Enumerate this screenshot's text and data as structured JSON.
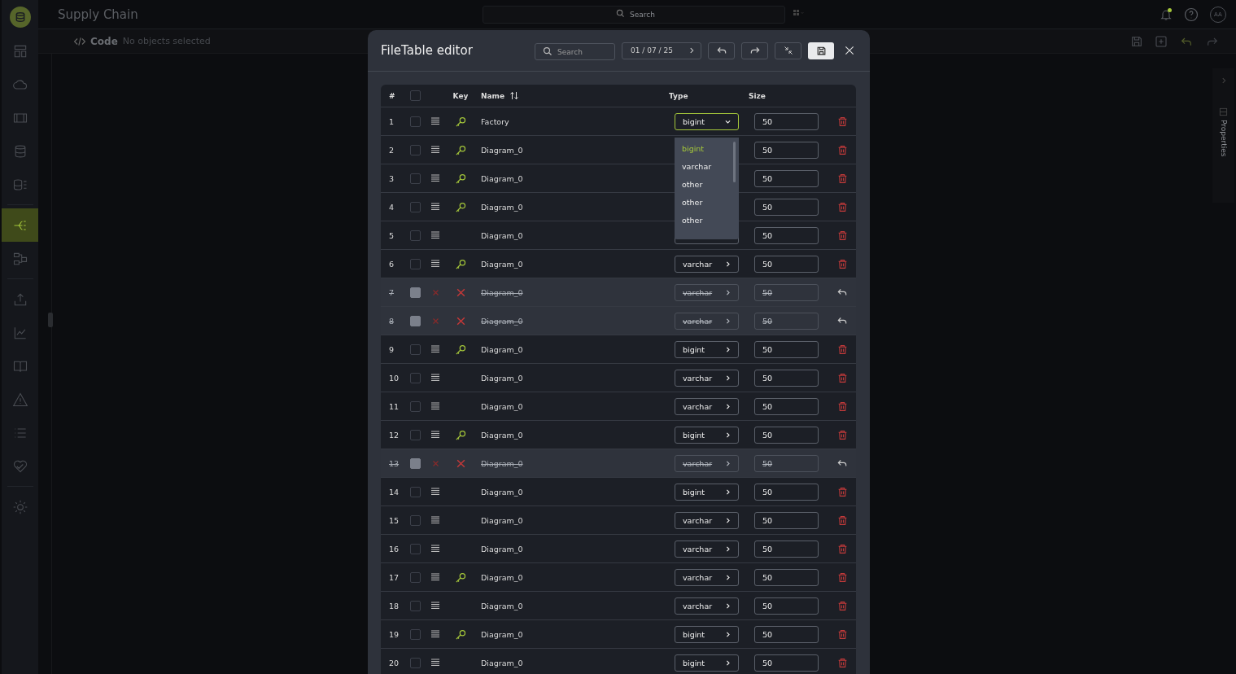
{
  "app": {
    "title": "Supply Chain",
    "search": {
      "placeholder": "Search"
    },
    "avatar": "AA",
    "notification": true
  },
  "toolbar": {
    "label": "Code",
    "status": "No objects selected"
  },
  "sidebar": {
    "items": [
      {
        "selected": false
      },
      {
        "selected": false
      },
      {
        "selected": false
      },
      {
        "selected": false
      },
      {
        "selected": false
      },
      {
        "selected": true
      },
      {
        "selected": false
      },
      {
        "selected": false
      },
      {
        "selected": false
      },
      {
        "selected": false
      },
      {
        "selected": false
      },
      {
        "selected": false
      },
      {
        "selected": false
      },
      {
        "selected": false
      }
    ]
  },
  "right_panel": {
    "label": "Properties"
  },
  "dialog": {
    "title": "FileTable editor",
    "search": {
      "placeholder": "Search"
    },
    "date": "01 / 07 / 25",
    "table": {
      "columns": {
        "number": "#",
        "key": "Key",
        "name": "Name",
        "type": "Type",
        "size": "Size"
      },
      "all_checked": false,
      "type_menu": {
        "options": [
          {
            "label": "bigint",
            "selected": true
          },
          {
            "label": "varchar",
            "selected": false
          },
          {
            "label": "other",
            "selected": false
          },
          {
            "label": "other",
            "selected": false
          },
          {
            "label": "other",
            "selected": false
          }
        ]
      },
      "rows": [
        {
          "number": "1",
          "checked": false,
          "key": true,
          "name": "Factory",
          "type": "bigint",
          "size": "50",
          "deleted": false,
          "menu_open": true
        },
        {
          "number": "2",
          "checked": false,
          "key": true,
          "name": "Diagram_0",
          "size": "50",
          "deleted": false,
          "menu_open": false
        },
        {
          "number": "3",
          "checked": false,
          "key": true,
          "name": "Diagram_0",
          "size": "50",
          "deleted": false,
          "menu_open": false
        },
        {
          "number": "4",
          "checked": false,
          "key": true,
          "name": "Diagram_0",
          "size": "50",
          "deleted": false,
          "menu_open": false
        },
        {
          "number": "5",
          "checked": false,
          "key": false,
          "name": "Diagram_0",
          "size": "50",
          "deleted": false,
          "menu_open": false
        },
        {
          "number": "6",
          "checked": false,
          "key": true,
          "name": "Diagram_0",
          "type": "varchar",
          "size": "50",
          "deleted": false,
          "menu_open": false
        },
        {
          "number": "7",
          "checked": true,
          "name": "Diagram_0",
          "type": "varchar",
          "size": "50",
          "deleted": true,
          "menu_open": false
        },
        {
          "number": "8",
          "checked": true,
          "name": "Diagram_0",
          "type": "varchar",
          "size": "50",
          "deleted": true,
          "menu_open": false
        },
        {
          "number": "9",
          "checked": false,
          "key": true,
          "name": "Diagram_0",
          "type": "bigint",
          "size": "50",
          "deleted": false,
          "menu_open": false
        },
        {
          "number": "10",
          "checked": false,
          "key": false,
          "name": "Diagram_0",
          "type": "varchar",
          "size": "50",
          "deleted": false,
          "menu_open": false
        },
        {
          "number": "11",
          "checked": false,
          "key": false,
          "name": "Diagram_0",
          "type": "varchar",
          "size": "50",
          "deleted": false,
          "menu_open": false
        },
        {
          "number": "12",
          "checked": false,
          "key": true,
          "name": "Diagram_0",
          "type": "bigint",
          "size": "50",
          "deleted": false,
          "menu_open": false
        },
        {
          "number": "13",
          "checked": true,
          "name": "Diagram_0",
          "type": "varchar",
          "size": "50",
          "deleted": true,
          "menu_open": false
        },
        {
          "number": "14",
          "checked": false,
          "key": false,
          "name": "Diagram_0",
          "type": "bigint",
          "size": "50",
          "deleted": false,
          "menu_open": false
        },
        {
          "number": "15",
          "checked": false,
          "key": false,
          "name": "Diagram_0",
          "type": "varchar",
          "size": "50",
          "deleted": false,
          "menu_open": false
        },
        {
          "number": "16",
          "checked": false,
          "key": false,
          "name": "Diagram_0",
          "type": "varchar",
          "size": "50",
          "deleted": false,
          "menu_open": false
        },
        {
          "number": "17",
          "checked": false,
          "key": true,
          "name": "Diagram_0",
          "type": "varchar",
          "size": "50",
          "deleted": false,
          "menu_open": false
        },
        {
          "number": "18",
          "checked": false,
          "key": false,
          "name": "Diagram_0",
          "type": "varchar",
          "size": "50",
          "deleted": false,
          "menu_open": false
        },
        {
          "number": "19",
          "checked": false,
          "key": true,
          "name": "Diagram_0",
          "type": "bigint",
          "size": "50",
          "deleted": false,
          "menu_open": false
        },
        {
          "number": "20",
          "checked": false,
          "key": false,
          "name": "Diagram_0",
          "type": "bigint",
          "size": "50",
          "deleted": false,
          "menu_open": false
        }
      ]
    }
  }
}
